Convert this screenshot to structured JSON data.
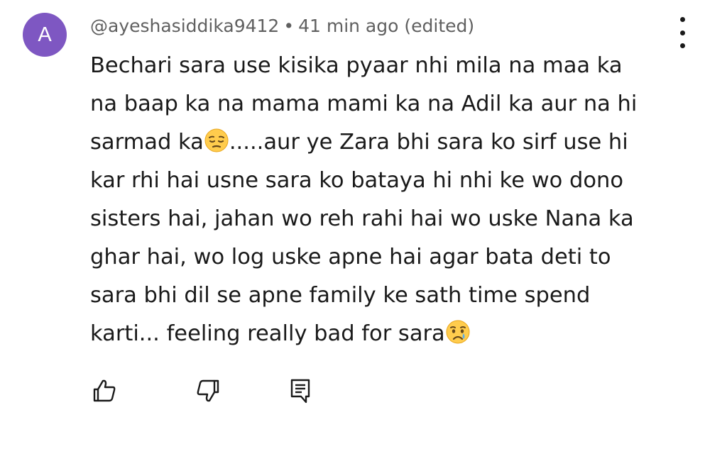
{
  "author": {
    "avatar_letter": "A",
    "avatar_color": "#7e57c2",
    "handle": "@ayeshasiddika9412",
    "separator": "•",
    "time": "41 min ago",
    "edited": "(edited)"
  },
  "comment": {
    "lines": [
      "Bechari sara use kisika pyaar nhi mila na maa ka",
      "na baap ka na mama mami ka na Adil ka aur na hi",
      "sarmad ka",
      ".....aur ye Zara bhi sara ko sirf use hi",
      "kar rhi hai usne sara ko bataya hi nhi ke wo dono",
      "sisters hai, jahan wo reh rahi hai wo uske Nana ka",
      "ghar hai, wo log uske apne hai agar bata deti to",
      "sara bhi dil se apne family ke sath time spend",
      "karti... feeling really bad for sara"
    ],
    "emojis": [
      "pensive-face-emoji",
      "crying-face-emoji"
    ]
  },
  "actions": {
    "like_icon": "thumbs-up-icon",
    "dislike_icon": "thumbs-down-icon",
    "reply_icon": "reply-comment-icon",
    "menu_icon": "more-vertical-icon"
  }
}
